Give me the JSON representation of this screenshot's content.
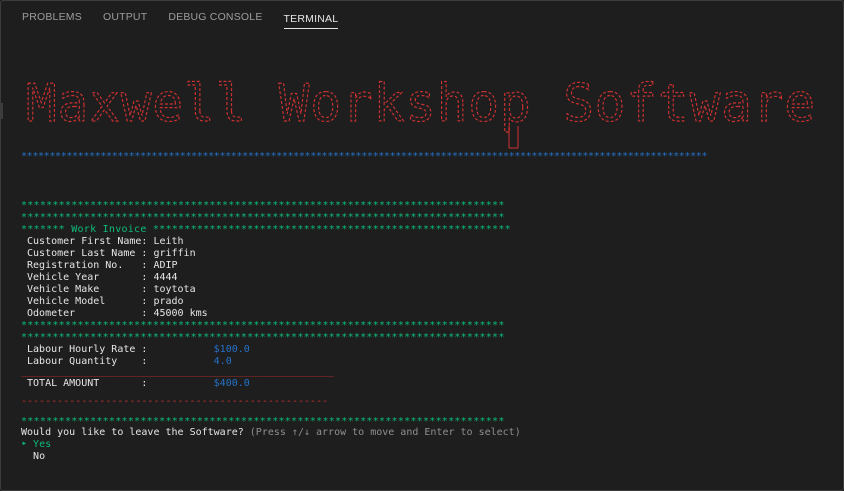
{
  "panel": {
    "tabs": [
      {
        "label": "PROBLEMS",
        "active": false
      },
      {
        "label": "OUTPUT",
        "active": false
      },
      {
        "label": "DEBUG CONSOLE",
        "active": false
      },
      {
        "label": "TERMINAL",
        "active": true
      }
    ]
  },
  "terminal": {
    "banner_text": "Maxwell Workshop Software",
    "banner_color": "#cd3131",
    "blue_separator": "*************************************************************************************************************************",
    "green_separator": "*****************************************************************************",
    "invoice_header": "******* Work Invoice *********************************************************",
    "customer_fields": [
      {
        "label": " Customer First Name:",
        "value": " Leith"
      },
      {
        "label": " Customer Last Name :",
        "value": " griffin"
      },
      {
        "label": " Registration No.   :",
        "value": " ADIP"
      },
      {
        "label": " Vehicle Year       :",
        "value": " 4444"
      },
      {
        "label": " Vehicle Make       :",
        "value": " toytota"
      },
      {
        "label": " Vehicle Model      :",
        "value": " prado"
      },
      {
        "label": " Odometer           :",
        "value": " 45000 kms"
      }
    ],
    "labour": [
      {
        "label": " Labour Hourly Rate :           ",
        "value": "$100.0"
      },
      {
        "label": " Labour Quantity    :           ",
        "value": "4.0"
      }
    ],
    "dash_line": "____________________________________________________",
    "dash_line2": "---------------------------------------------------",
    "total": {
      "label": " TOTAL AMOUNT       :           ",
      "value": "$400.0"
    },
    "prompt": {
      "question": "Would you like to leave the Software?",
      "hint": " (Press ↑/↓ arrow to move and Enter to select)",
      "pointer": "‣ ",
      "options": [
        "Yes",
        "No"
      ]
    },
    "colors": {
      "green": "#0dbc79",
      "blue": "#2472c8",
      "red": "#cd3131"
    }
  }
}
